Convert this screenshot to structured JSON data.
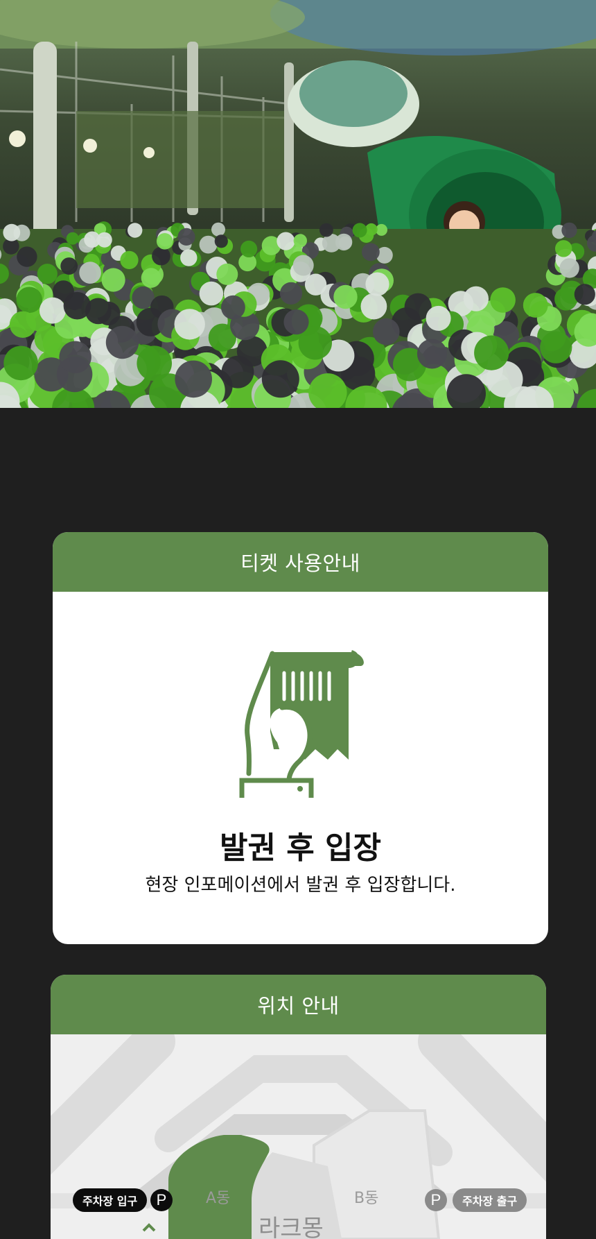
{
  "ticket_card": {
    "header": "티켓 사용안내",
    "title": "발권 후 입장",
    "description": "현장 인포메이션에서 발권 후 입장합니다."
  },
  "location_card": {
    "header": "위치 안내",
    "map": {
      "parking_entrance": "주차장 입구",
      "parking_exit": "주차장 출구",
      "parking_symbol": "P",
      "building_a": "A동",
      "building_b": "B동",
      "mall_name": "라크몽"
    }
  },
  "colors": {
    "accent_green": "#5f8b4c",
    "background": "#1f1f1f"
  },
  "icons": {
    "ticket": "hand-holding-ticket-icon"
  }
}
